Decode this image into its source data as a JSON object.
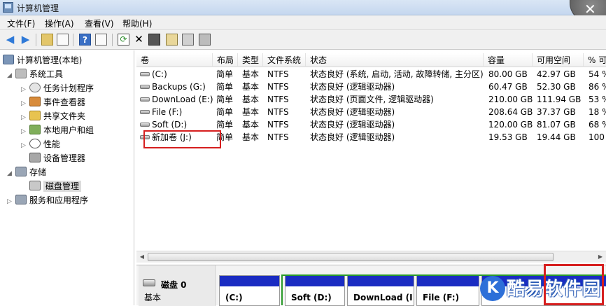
{
  "window": {
    "title": "计算机管理",
    "close_symbol": "✕"
  },
  "menu": [
    "文件(F)",
    "操作(A)",
    "查看(V)",
    "帮助(H)"
  ],
  "toolbar_icons": [
    "back-icon",
    "forward-icon",
    "up-folder-icon",
    "show-hide-tree-icon",
    "help-icon",
    "properties-pane-icon",
    "refresh-icon",
    "delete-icon",
    "properties-icon",
    "search-disk-icon",
    "settings-icon"
  ],
  "tree": {
    "root": "计算机管理(本地)",
    "system_tools": "系统工具",
    "task_scheduler": "任务计划程序",
    "event_viewer": "事件查看器",
    "shared_folders": "共享文件夹",
    "local_users": "本地用户和组",
    "performance": "性能",
    "device_manager": "设备管理器",
    "storage": "存储",
    "disk_management": "磁盘管理",
    "services": "服务和应用程序"
  },
  "volume_table": {
    "headers": [
      "卷",
      "布局",
      "类型",
      "文件系统",
      "状态",
      "容量",
      "可用空间",
      "% 可"
    ],
    "rows": [
      [
        "(C:)",
        "简单",
        "基本",
        "NTFS",
        "状态良好 (系统, 启动, 活动, 故障转储, 主分区)",
        "80.00 GB",
        "42.97 GB",
        "54 %"
      ],
      [
        "Backups (G:)",
        "简单",
        "基本",
        "NTFS",
        "状态良好 (逻辑驱动器)",
        "60.47 GB",
        "52.30 GB",
        "86 %"
      ],
      [
        "DownLoad (E:)",
        "简单",
        "基本",
        "NTFS",
        "状态良好 (页面文件, 逻辑驱动器)",
        "210.00 GB",
        "111.94 GB",
        "53 %"
      ],
      [
        "File (F:)",
        "简单",
        "基本",
        "NTFS",
        "状态良好 (逻辑驱动器)",
        "208.64 GB",
        "37.37 GB",
        "18 %"
      ],
      [
        "Soft (D:)",
        "简单",
        "基本",
        "NTFS",
        "状态良好 (逻辑驱动器)",
        "120.00 GB",
        "81.07 GB",
        "68 %"
      ],
      [
        "新加卷 (J:)",
        "简单",
        "基本",
        "NTFS",
        "状态良好 (逻辑驱动器)",
        "19.53 GB",
        "19.44 GB",
        "100"
      ]
    ]
  },
  "disk_map": {
    "disk_name": "磁盘 0",
    "disk_type": "基本",
    "partitions": [
      "(C:)",
      "Soft  (D:)",
      "DownLoad  (I",
      "File  (F:)"
    ],
    "partition_color": "#1a2cc2"
  },
  "watermark": {
    "text": "酷易软件园",
    "logo_letter": "K"
  },
  "accent": {
    "highlight_red": "#d61f1f",
    "logical_green": "#2a9a2a"
  }
}
